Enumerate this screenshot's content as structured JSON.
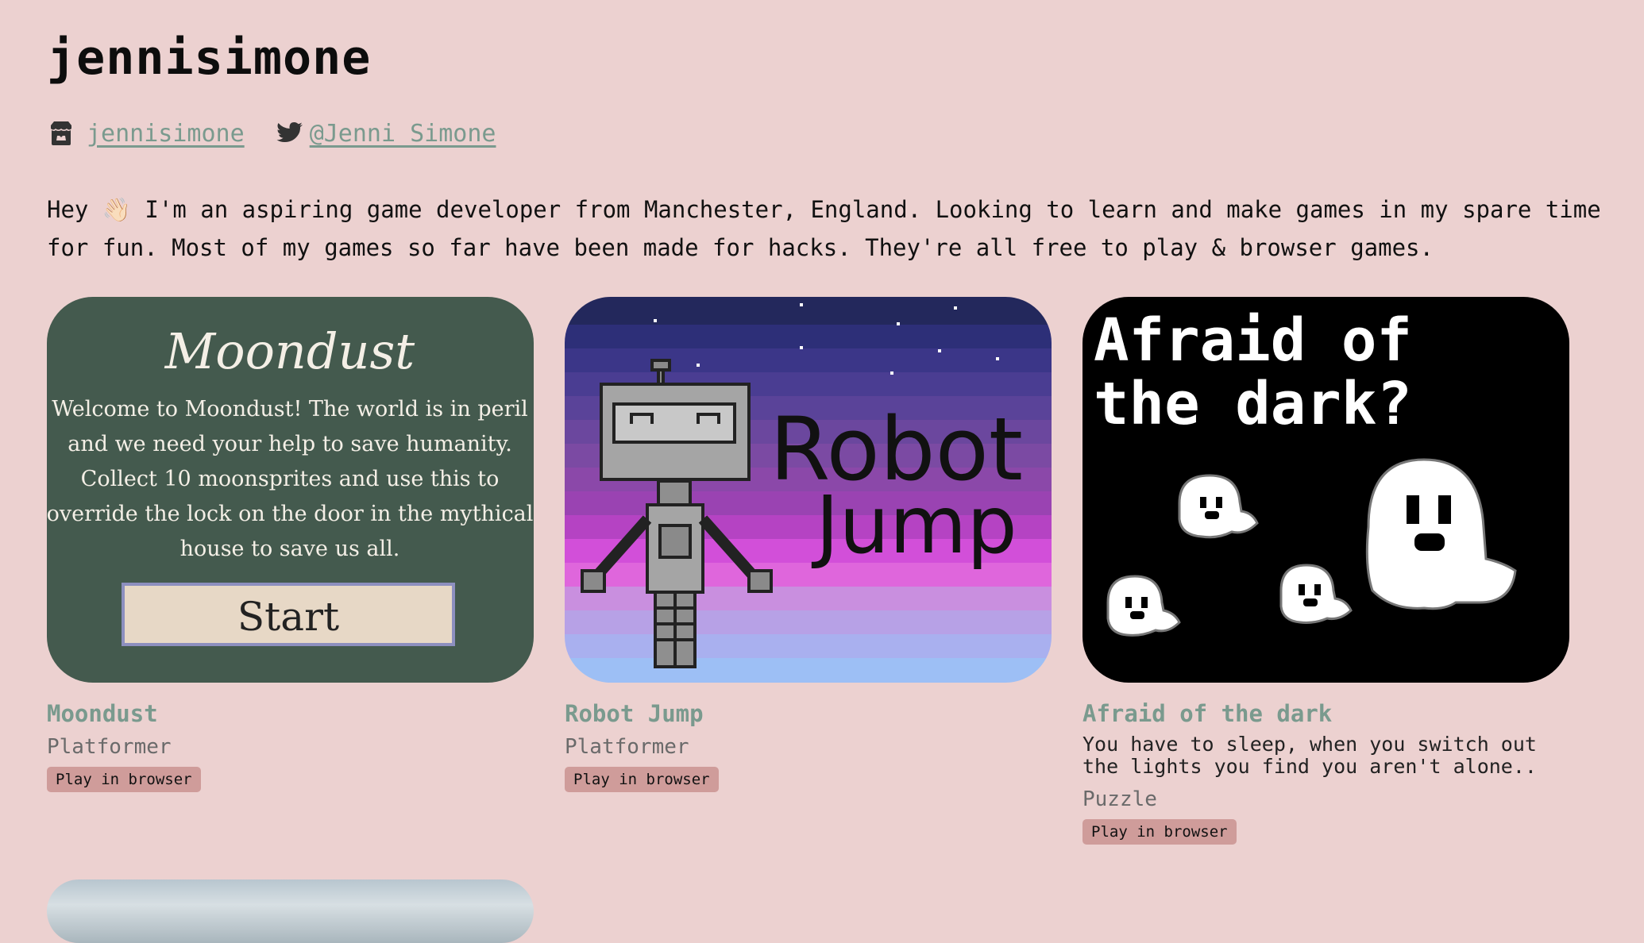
{
  "profile": {
    "name": "jennisimone",
    "itch_link": "jennisimone",
    "twitter_link": "@Jenni_Simone",
    "bio_prefix": "Hey ",
    "wave_emoji": "👋🏻",
    "bio_text": " I'm an aspiring game developer from Manchester, England. Looking to learn and make games in my spare time for fun. Most of my games so far have been made for hacks. They're all free to play & browser games."
  },
  "icons": {
    "itch": "itch-io-icon",
    "twitter": "twitter-bird-icon"
  },
  "games": [
    {
      "title": "Moondust",
      "genre": "Platformer",
      "play_label": "Play in browser",
      "thumb": {
        "heading": "Moondust",
        "lines": [
          "Welcome to Moondust! The world is in peril",
          "and we need your help to save humanity.",
          "Collect 10 moonsprites and use this to",
          "override the lock on the door in the mythical",
          "house to save us all."
        ],
        "button": "Start",
        "bg": "#445a4e"
      }
    },
    {
      "title": "Robot Jump",
      "genre": "Platformer",
      "play_label": "Play in browser",
      "thumb": {
        "line1": "Robot",
        "line2": "Jump"
      }
    },
    {
      "title": "Afraid of the dark",
      "description": "You have to sleep, when you switch out the lights you find you aren't alone..",
      "genre": "Puzzle",
      "play_label": "Play in browser",
      "thumb": {
        "line1": "Afraid of",
        "line2": "the dark?"
      }
    }
  ],
  "colors": {
    "background": "#ecd1d0",
    "link": "#7a9a8e",
    "badge": "#cf9c9a"
  }
}
